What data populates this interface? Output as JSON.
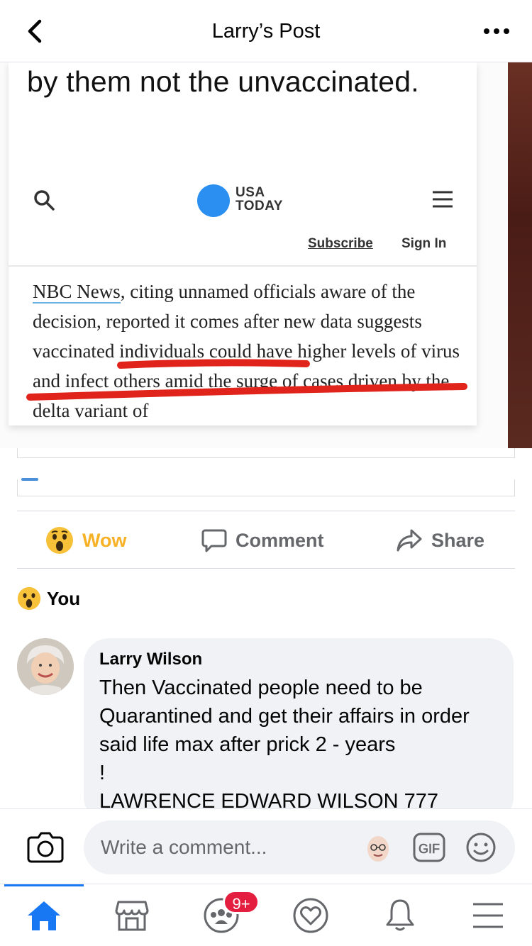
{
  "header": {
    "title": "Larry’s Post"
  },
  "shared_image": {
    "headline_tail": "by them not the unvaccinated.",
    "brand_line1": "USA",
    "brand_line2": "TODAY",
    "subscribe": "Subscribe",
    "sign_in": "Sign In",
    "article_nbc": "NBC News",
    "article_rest": ", citing unnamed officials aware of the decision, reported it comes after new data suggests vaccinated individuals could have higher levels of virus and infect others amid the surge of cases driven by the delta variant of"
  },
  "actions": {
    "wow": "Wow",
    "comment": "Comment",
    "share": "Share"
  },
  "reactions": {
    "you": "You"
  },
  "comment": {
    "author": "Larry Wilson",
    "text": "Then Vaccinated people need to be Quarantined and get their affairs in order said life max after prick 2 - years\n!\nLAWRENCE EDWARD WILSON 777"
  },
  "composer": {
    "placeholder": "Write a comment..."
  },
  "tabbar": {
    "badge": "9+"
  },
  "colors": {
    "accent": "#1877f2",
    "wow": "#f7b125",
    "badge": "#e41e3f",
    "usa_today_blue": "#2a8ff1",
    "marker_red": "#e0241b"
  }
}
